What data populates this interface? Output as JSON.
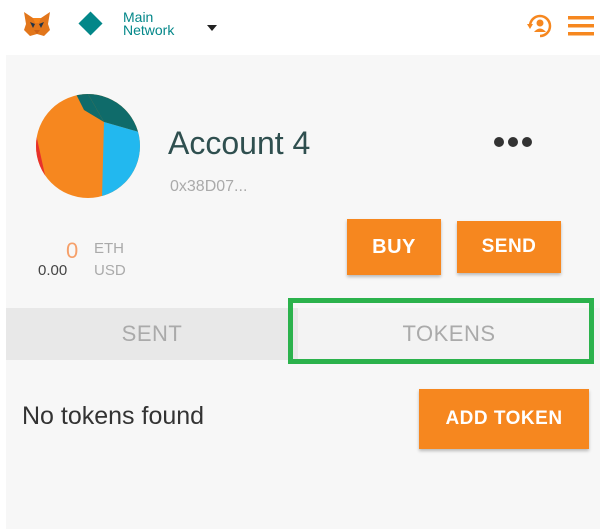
{
  "header": {
    "network_line1": "Main",
    "network_line2": "Network",
    "network_color": "#038789"
  },
  "account": {
    "name": "Account 4",
    "address": "0x38D07...",
    "menu_icon": "more-dots-icon"
  },
  "balance": {
    "eth_value": "0",
    "eth_unit": "ETH",
    "usd_value": "0.00",
    "usd_unit": "USD"
  },
  "actions": {
    "buy_label": "BUY",
    "send_label": "SEND",
    "accent_color": "#f6871f"
  },
  "tabs": [
    {
      "label": "SENT",
      "active": false
    },
    {
      "label": "TOKENS",
      "active": true
    }
  ],
  "tokens": {
    "empty_message": "No tokens found",
    "add_label": "ADD TOKEN"
  },
  "highlight_color": "#2bb24c"
}
